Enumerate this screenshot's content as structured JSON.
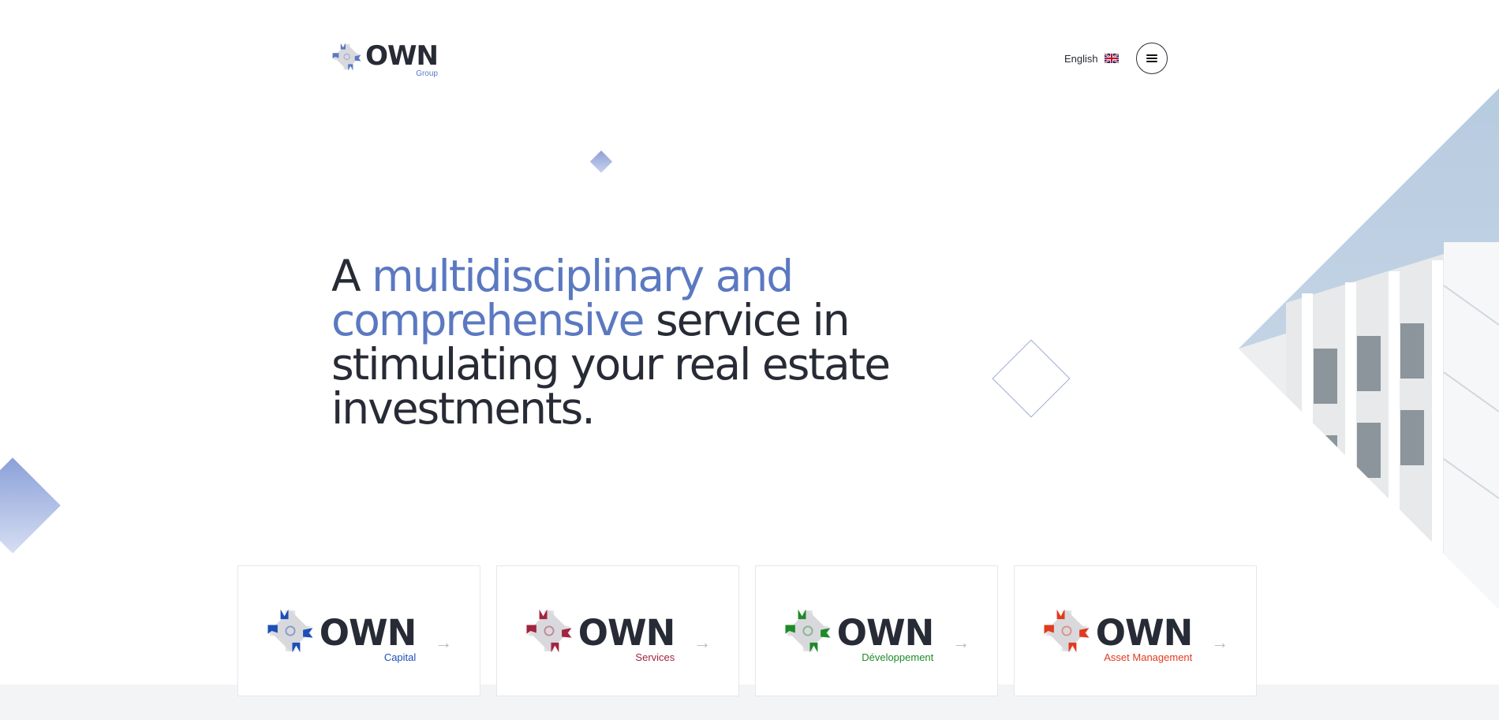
{
  "header": {
    "logo": {
      "brand": "OWN",
      "sub": "Group",
      "color": "#5b79c1"
    },
    "language": {
      "label": "English",
      "flag_icon": "uk-flag-icon"
    },
    "menu_icon": "hamburger-icon"
  },
  "hero": {
    "title_prefix": "A ",
    "title_accent": "multidisciplinary and comprehensive",
    "title_suffix": " service in stimulating your real estate investments.",
    "accent_color": "#5b79c1"
  },
  "cards": [
    {
      "brand": "OWN",
      "sub": "Capital",
      "color": "#1d4fb8"
    },
    {
      "brand": "OWN",
      "sub": "Services",
      "color": "#a3243f"
    },
    {
      "brand": "OWN",
      "sub": "Développement",
      "color": "#1f8a2a"
    },
    {
      "brand": "OWN",
      "sub": "Asset Management",
      "color": "#e13b1f"
    }
  ],
  "card_arrow": "→"
}
